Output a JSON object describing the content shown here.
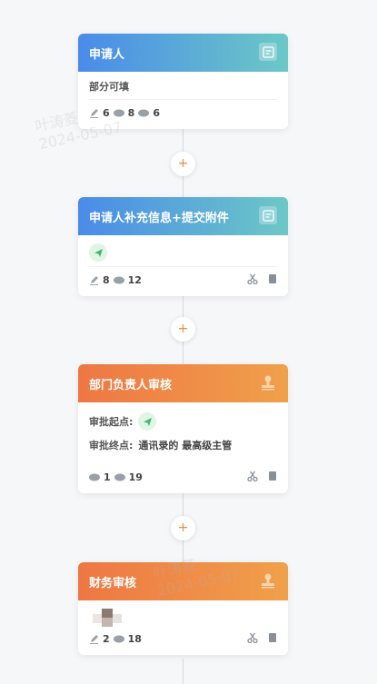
{
  "nodes": [
    {
      "title": "申请人",
      "theme": "blue",
      "header_icon": "form-icon",
      "description": "部分可填",
      "stats": {
        "edit": "6",
        "view": "8",
        "hide": "6"
      }
    },
    {
      "title": "申请人补充信息+提交附件",
      "theme": "blue",
      "header_icon": "form-icon",
      "action_icon": "send-icon",
      "stats": {
        "edit": "8",
        "view": "12"
      }
    },
    {
      "title": "部门负责人审核",
      "theme": "orange",
      "header_icon": "approver-stamp-icon",
      "start_label": "审批起点:",
      "end_label": "审批终点:",
      "end_value": "通讯录的 最高级主管",
      "stats": {
        "view": "1",
        "hide": "19"
      }
    },
    {
      "title": "财务审核",
      "theme": "orange",
      "header_icon": "approver-stamp-icon",
      "stats": {
        "edit": "2",
        "view": "18"
      }
    }
  ],
  "add_button_label": "+",
  "watermarks": [
    {
      "name": "叶涛菱",
      "date": "2024-05-07"
    },
    {
      "name": "叶涛菱",
      "date": "2024-05-07"
    }
  ],
  "colors": {
    "blue_start": "#4a8be9",
    "blue_end": "#6cc8c6",
    "orange_start": "#ee7744",
    "orange_end": "#f0a04a",
    "send_green": "#3cb86e"
  }
}
